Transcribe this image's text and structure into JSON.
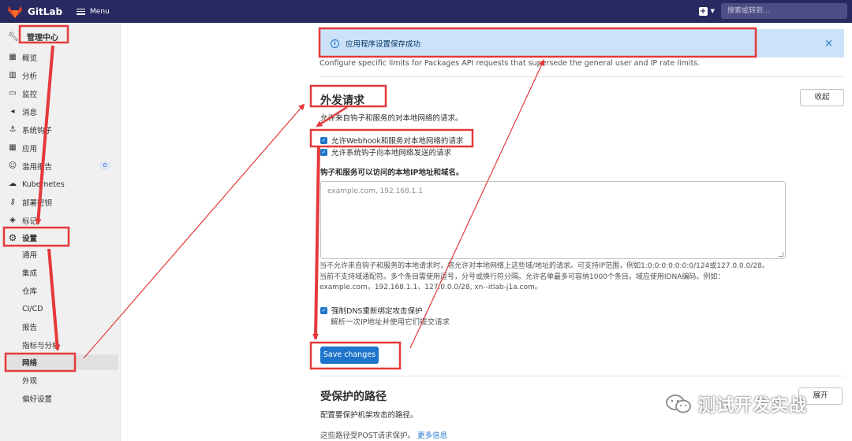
{
  "topbar": {
    "app_name": "GitLab",
    "menu_label": "Menu",
    "plus_label": "+",
    "search_placeholder": "搜索或转到..."
  },
  "sidebar": {
    "header": "管理中心",
    "items": [
      {
        "label": "概览",
        "icon": "grid-icon"
      },
      {
        "label": "分析",
        "icon": "chart-icon"
      },
      {
        "label": "监控",
        "icon": "monitor-icon"
      },
      {
        "label": "消息",
        "icon": "bullhorn-icon"
      },
      {
        "label": "系统钩子",
        "icon": "hook-icon"
      },
      {
        "label": "应用",
        "icon": "apps-icon"
      },
      {
        "label": "滥用报告",
        "icon": "flag-icon",
        "badge": "0"
      },
      {
        "label": "Kubernetes",
        "icon": "kubernetes-icon"
      },
      {
        "label": "部署密钥",
        "icon": "key-icon"
      },
      {
        "label": "标记",
        "icon": "label-icon"
      },
      {
        "label": "设置",
        "icon": "gear-icon"
      }
    ],
    "sub_items": [
      "通用",
      "集成",
      "仓库",
      "CI/CD",
      "报告",
      "指标与分析",
      "网络",
      "外观",
      "偏好设置"
    ],
    "active_sub": "网络"
  },
  "main": {
    "alert_text": "应用程序设置保存成功",
    "close_symbol": "×",
    "desc_top": "Configure specific limits for Packages API requests that supersede the general user and IP rate limits.",
    "outbound": {
      "title": "外发请求",
      "subtitle": "允许来自钩子和服务的对本地网络的请求。",
      "collapse_label": "收起",
      "cb1_label": "允许Webhook和服务对本地网络的请求",
      "cb2_label": "允许系统钩子向本地网络发送的请求",
      "field_label": "钩子和服务可以访问的本地IP地址和域名。",
      "textarea_placeholder": "example.com, 192.168.1.1",
      "help_line1": "当不允许来自钩子和服务的本地请求时，将允许对本地网络上这些域/地址的请求。可支持IP范围，例如1:0:0:0:0:0:0:0/124或127.0.0.0/28。",
      "help_line2": "当前不支持域通配符。多个条目需使用逗号，分号或换行符分隔。允许名单最多可容纳1000个条目。域应使用IDNA编码。例如：",
      "help_line3": "example.com，192.168.1.1、127.0.0.0/28, xn--itlab-j1a.com。",
      "dns_label": "强制DNS重新绑定攻击保护",
      "dns_sub": "解析一次IP地址并使用它们提交请求",
      "save_label": "Save changes"
    },
    "protected": {
      "title": "受保护的路径",
      "subtitle": "配置要保护机架攻击的路径。",
      "note": "这些路径受POST请求保护。",
      "more_link": "更多信息",
      "expand_label": "展开"
    }
  },
  "watermark": {
    "text": "测试开发实战"
  },
  "colors": {
    "navbar": "#292961",
    "primary": "#1f75cb",
    "annotation": "#e5393a",
    "alert_bg": "#cbe2f9"
  }
}
